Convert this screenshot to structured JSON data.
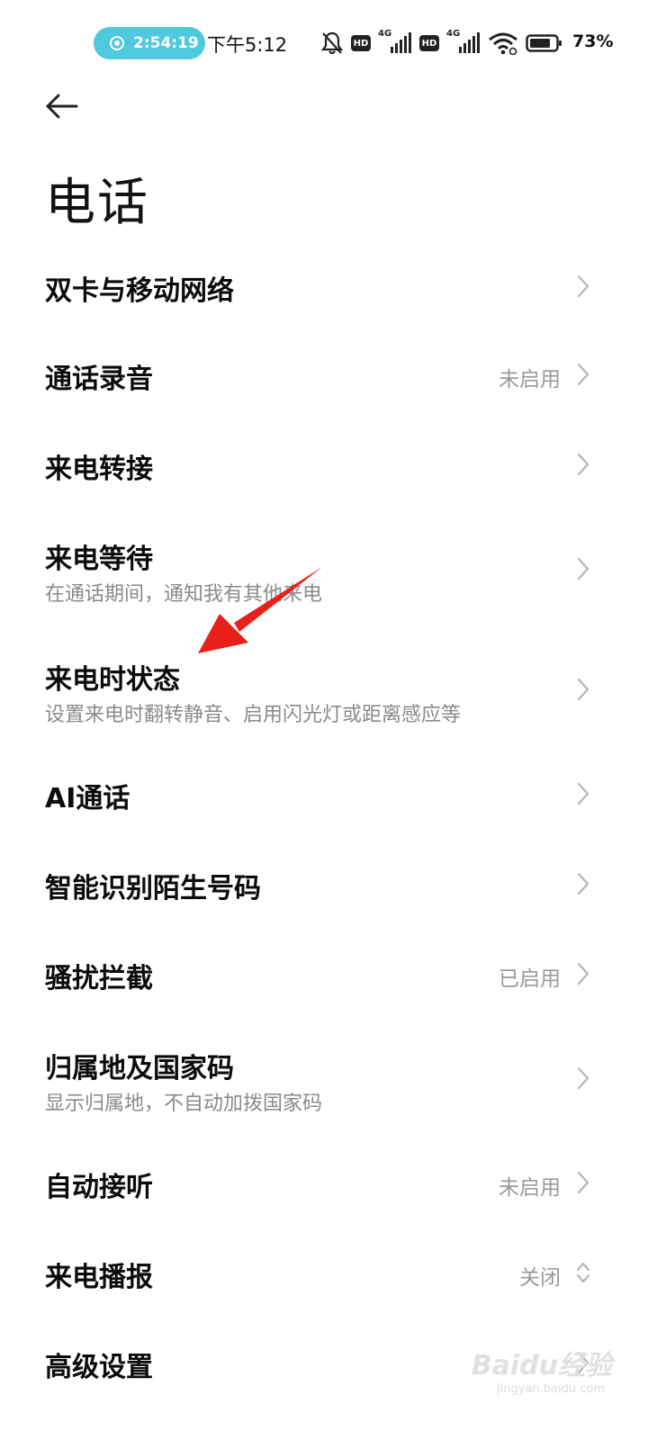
{
  "status_bar": {
    "recording_timer": "2:54:19",
    "clock": "下午5:12",
    "hd_badge": "HD",
    "network_type": "4G",
    "battery_percent": "73%",
    "icons": [
      "bell-off-icon",
      "hd-icon",
      "signal-icon",
      "hd-icon",
      "signal-icon",
      "wifi-icon",
      "battery-icon"
    ]
  },
  "header": {
    "back_icon": "arrow-left-icon",
    "title": "电话"
  },
  "items": [
    {
      "title": "双卡与移动网络",
      "subtitle": "",
      "value": "",
      "control": "chevron-right-icon"
    },
    {
      "title": "通话录音",
      "subtitle": "",
      "value": "未启用",
      "control": "chevron-right-icon"
    },
    {
      "title": "来电转接",
      "subtitle": "",
      "value": "",
      "control": "chevron-right-icon"
    },
    {
      "title": "来电等待",
      "subtitle": "在通话期间，通知我有其他来电",
      "value": "",
      "control": "chevron-right-icon"
    },
    {
      "title": "来电时状态",
      "subtitle": "设置来电时翻转静音、启用闪光灯或距离感应等",
      "value": "",
      "control": "chevron-right-icon"
    },
    {
      "title": "AI通话",
      "subtitle": "",
      "value": "",
      "control": "chevron-right-icon"
    },
    {
      "title": "智能识别陌生号码",
      "subtitle": "",
      "value": "",
      "control": "chevron-right-icon"
    },
    {
      "title": "骚扰拦截",
      "subtitle": "",
      "value": "已启用",
      "control": "chevron-right-icon"
    },
    {
      "title": "归属地及国家码",
      "subtitle": "显示归属地，不自动加拨国家码",
      "value": "",
      "control": "chevron-right-icon"
    },
    {
      "title": "自动接听",
      "subtitle": "",
      "value": "未启用",
      "control": "chevron-right-icon"
    },
    {
      "title": "来电播报",
      "subtitle": "",
      "value": "关闭",
      "control": "chevron-updown-icon"
    },
    {
      "title": "高级设置",
      "subtitle": "",
      "value": "",
      "control": "chevron-right-icon"
    }
  ],
  "annotation": {
    "icon": "red-arrow-icon",
    "color": "#e8201a"
  },
  "watermark": {
    "brand": "Baidu经验",
    "url": "jingyan.baidu.com"
  },
  "colors": {
    "accent_pill": "#4fc9de",
    "title": "#0b0b0b",
    "secondary": "#8a8a8a",
    "chevron": "#b5b5b5"
  }
}
